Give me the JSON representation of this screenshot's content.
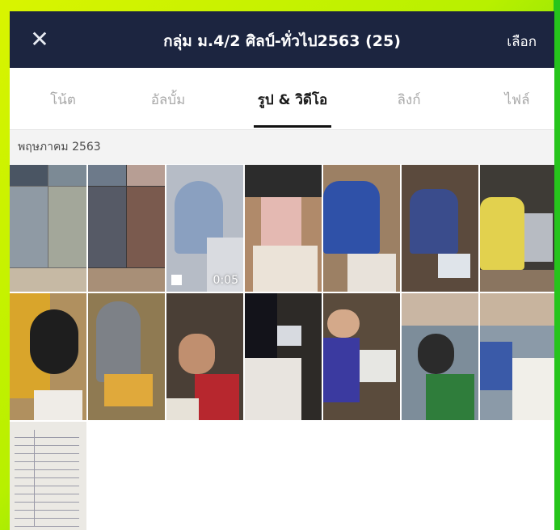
{
  "header": {
    "close_icon": "close-icon",
    "title": "กลุ่ม ม.4/2 ศิลป์-ทั่วไป2563 (25)",
    "select_label": "เลือก"
  },
  "tabs": [
    {
      "label": "โน้ต",
      "active": false
    },
    {
      "label": "อัลบั้ม",
      "active": false
    },
    {
      "label": "รูป & วิดีโอ",
      "active": true
    },
    {
      "label": "ลิงก์",
      "active": false
    },
    {
      "label": "ไฟล์",
      "active": false
    }
  ],
  "section": {
    "label": "พฤษภาคม 2563"
  },
  "media": {
    "video_duration": "0:05"
  },
  "colors": {
    "navbar": "#1c2540",
    "frame_left": "#d9f400",
    "frame_right": "#22c21a"
  }
}
